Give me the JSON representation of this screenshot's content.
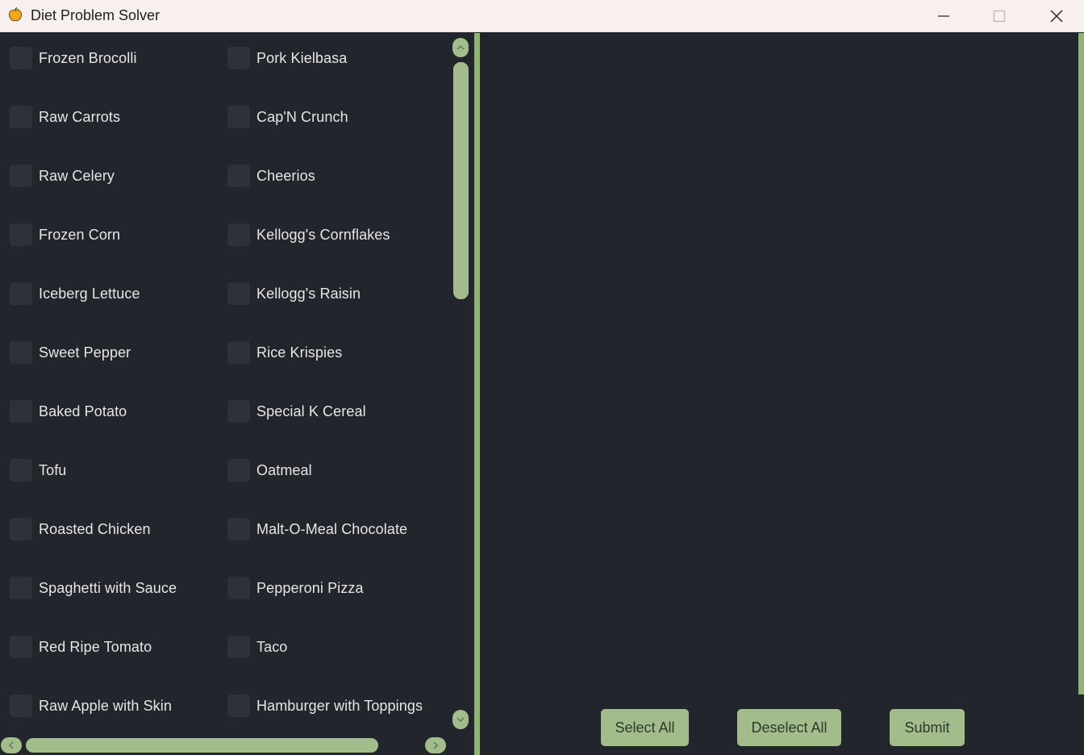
{
  "window": {
    "title": "Diet Problem Solver",
    "app_icon": "apple-icon",
    "controls": {
      "minimize_icon": "minimize-icon",
      "maximize_icon": "maximize-icon",
      "close_icon": "close-icon"
    }
  },
  "colors": {
    "background": "#22252b",
    "checkbox": "#2d313a",
    "accent": "#a3bc8c",
    "divider": "#8fb373",
    "text": "#e6e6e6",
    "titlebar": "#f8f0ee"
  },
  "foods": {
    "column1": [
      "Frozen Brocolli",
      "Raw Carrots",
      "Raw Celery",
      "Frozen Corn",
      "Iceberg Lettuce",
      "Sweet Pepper",
      "Baked Potato",
      "Tofu",
      "Roasted Chicken",
      "Spaghetti with Sauce",
      "Red Ripe Tomato",
      "Raw Apple with Skin"
    ],
    "column2": [
      "Pork Kielbasa",
      "Cap'N Crunch",
      "Cheerios",
      "Kellogg's Cornflakes",
      "Kellogg's Raisin",
      "Rice Krispies",
      "Special K Cereal",
      "Oatmeal",
      "Malt-O-Meal Chocolate",
      "Pepperoni Pizza",
      "Taco",
      "Hamburger with Toppings"
    ]
  },
  "scrollbars": {
    "up_icon": "chevron-up-icon",
    "down_icon": "chevron-down-icon",
    "left_icon": "chevron-left-icon",
    "right_icon": "chevron-right-icon"
  },
  "buttons": {
    "select_all": "Select All",
    "deselect_all": "Deselect All",
    "submit": "Submit"
  }
}
